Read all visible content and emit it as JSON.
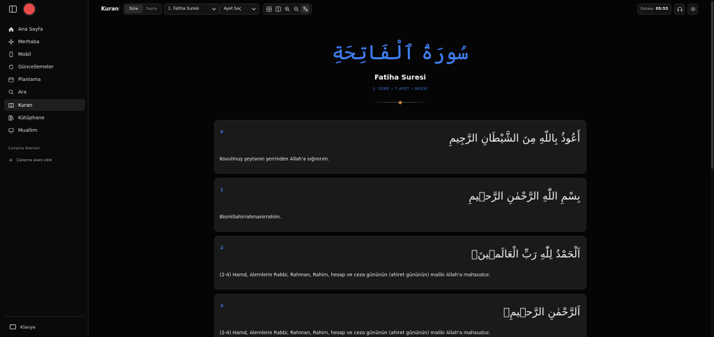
{
  "sidebar": {
    "nav": [
      {
        "label": "Ana Sayfa",
        "icon": "home-icon"
      },
      {
        "label": "Merhaba",
        "icon": "sparkle-icon"
      },
      {
        "label": "Mobil",
        "icon": "phone-icon"
      },
      {
        "label": "Güncellemeler",
        "icon": "refresh-icon"
      },
      {
        "label": "Planlama",
        "icon": "calendar-icon"
      },
      {
        "label": "Ara",
        "icon": "search-icon"
      },
      {
        "label": "Kuran",
        "icon": "book-icon",
        "active": true
      },
      {
        "label": "Kütüphane",
        "icon": "library-icon"
      },
      {
        "label": "Muallim",
        "icon": "teacher-icon"
      }
    ],
    "workspaces_title": "Çalışma Alanları",
    "add_workspace": "Çalışma alanı ekle",
    "keyboard_label": "Klavye",
    "avatar_color": "#e84a4a"
  },
  "topbar": {
    "title": "Kuran",
    "separator": "/",
    "mode_tabs": [
      "Sûre",
      "Sayfa"
    ],
    "surah_select": "1. Fatiha Suresi",
    "ayet_select": "Ayet Seç",
    "sun_label": "Güneş",
    "sun_time": "05:55"
  },
  "header": {
    "arabic_title": "سُورَةُ ٱلْفَاتِحَةِ",
    "name": "Fatiha Suresi",
    "meta": "1. SÛRE • 7 AYET • MEKKÎ",
    "accent_color": "#3f7ff2"
  },
  "verses": [
    {
      "num": "0",
      "arabic": "أَعُوذُ بِاللّهِ مِنَ الشَّيْطَانِ الرَّجِيمِ",
      "translation": "Kovulmuş şeytanın şerrinden Allah'a sığınırım."
    },
    {
      "num": "1",
      "arabic": "بِسْمِ اللّٰهِ الرَّحْمٰنِ الرَّح۪يمِ",
      "translation": "Bismillahirrahmanirrahim."
    },
    {
      "num": "2",
      "arabic": "اَلْحَمْدُ لِلّٰهِ رَبِّ الْعَالَم۪ينَۙ",
      "translation": "(2-4) Hamd, Alemlerin Rabbi, Rahman, Rahim, hesap ve ceza gününün (ahiret gününün) maliki Allah'a mahsustur."
    },
    {
      "num": "3",
      "arabic": "اَلرَّحْمٰنِ الرَّح۪يمِۙ",
      "translation": "(2-4) Hamd, Alemlerin Rabbi, Rahman, Rahim, hesap ve ceza gününün (ahiret gününün) maliki Allah'a mahsustur."
    }
  ]
}
